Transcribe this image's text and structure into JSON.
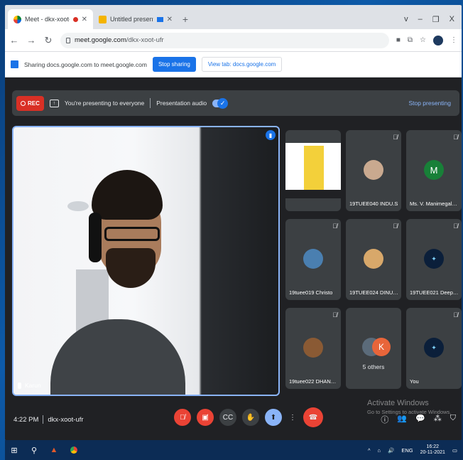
{
  "browser": {
    "tabs": [
      {
        "title": "Meet - dkx-xoot-ufr",
        "active": true
      },
      {
        "title": "Untitled presentation - Goo",
        "active": false
      }
    ],
    "url_host": "meet.google.com",
    "url_path": "/dkx-xoot-ufr",
    "window_controls": [
      "v",
      "–",
      "❐",
      "X"
    ]
  },
  "sharebar": {
    "text": "Sharing docs.google.com to meet.google.com",
    "stop_label": "Stop sharing",
    "view_label": "View tab: docs.google.com"
  },
  "present_bar": {
    "rec_label": "REC",
    "presenting_text": "You're presenting to everyone",
    "audio_label": "Presentation audio",
    "stop_label": "Stop presenting"
  },
  "main_tile": {
    "name": "Karun"
  },
  "participants": [
    {
      "name": "",
      "kind": "poster"
    },
    {
      "name": "19TUEE040 INDU.S",
      "kind": "photo",
      "color": "#c9a98f"
    },
    {
      "name": "Ms. V. Manimegalai ...",
      "kind": "letter",
      "letter": "M",
      "color": "#188038"
    },
    {
      "name": "19tuee019 Christo",
      "kind": "photo",
      "color": "#4a7fb0"
    },
    {
      "name": "19TUEE024 DINUM...",
      "kind": "photo",
      "color": "#d8a86a"
    },
    {
      "name": "19TUEE021 Deepanr...",
      "kind": "logo"
    },
    {
      "name": "19tuee022 DHANAP...",
      "kind": "photo",
      "color": "#8a5a34"
    },
    {
      "name": "5 others",
      "kind": "stack",
      "letter": "K"
    },
    {
      "name": "You",
      "kind": "logo"
    }
  ],
  "meeting": {
    "time": "4:22 PM",
    "code": "dkx-xoot-ufr"
  },
  "watermark": {
    "line1": "Activate Windows",
    "line2": "Go to Settings to activate Windows."
  },
  "taskbar": {
    "lang": "ENG",
    "time": "16:22",
    "date": "20-11-2021"
  }
}
